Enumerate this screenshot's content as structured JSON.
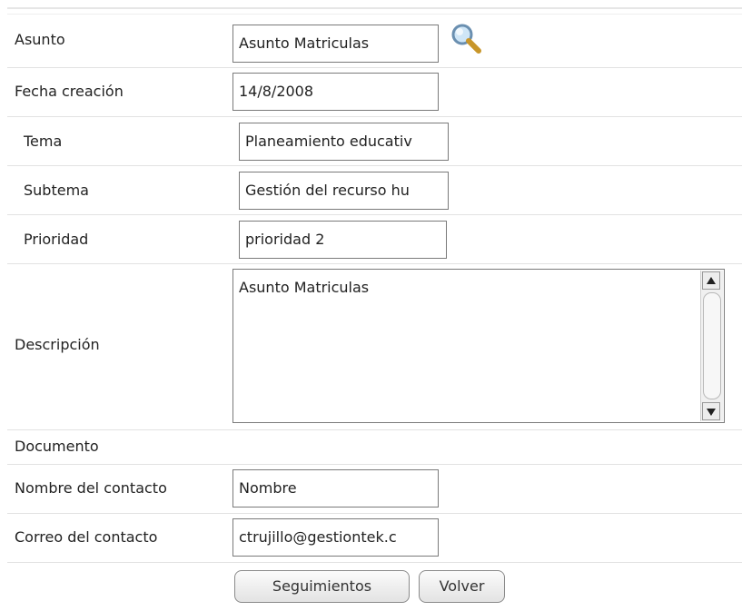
{
  "form": {
    "asunto": {
      "label": "Asunto",
      "value": "Asunto Matriculas"
    },
    "fecha": {
      "label": "Fecha creación",
      "value": "14/8/2008"
    },
    "tema": {
      "label": "Tema",
      "value": "Planeamiento educativ"
    },
    "subtema": {
      "label": "Subtema",
      "value": "Gestión del recurso hu"
    },
    "prioridad": {
      "label": "Prioridad",
      "value": "prioridad 2"
    },
    "descripcion": {
      "label": "Descripción",
      "value": "Asunto Matriculas"
    },
    "documento": {
      "label": "Documento"
    },
    "nombre": {
      "label": "Nombre del contacto",
      "value": "Nombre"
    },
    "correo": {
      "label": "Correo del contacto",
      "value": "ctrujillo@gestiontek.c"
    }
  },
  "buttons": {
    "seguimientos": "Seguimientos",
    "volver": "Volver"
  },
  "icons": {
    "search": "magnifier-icon"
  }
}
